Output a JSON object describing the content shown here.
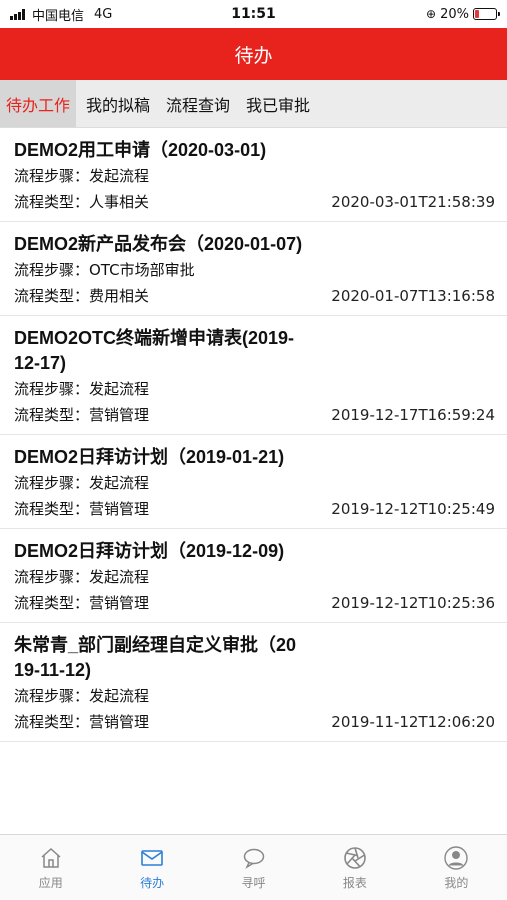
{
  "status_bar": {
    "carrier": "中国电信",
    "network": "4G",
    "time": "11:51",
    "battery_text": "20%",
    "battery_level": 0.2
  },
  "header": {
    "title": "待办"
  },
  "tabs": [
    {
      "label": "待办工作",
      "active": true
    },
    {
      "label": "我的拟稿",
      "active": false
    },
    {
      "label": "流程查询",
      "active": false
    },
    {
      "label": "我已审批",
      "active": false
    }
  ],
  "items": [
    {
      "title": "DEMO2用工申请（2020-03-01)",
      "step": "流程步骤：发起流程",
      "type": "流程类型：人事相关",
      "time": "2020-03-01T21:58:39"
    },
    {
      "title": "DEMO2新产品发布会（2020-01-07)",
      "step": "流程步骤：OTC市场部审批",
      "type": "流程类型：费用相关",
      "time": "2020-01-07T13:16:58"
    },
    {
      "title": "DEMO2OTC终端新增申请表(2019-12-17)",
      "step": "流程步骤：发起流程",
      "type": "流程类型：营销管理",
      "time": "2019-12-17T16:59:24"
    },
    {
      "title": "DEMO2日拜访计划（2019-01-21)",
      "step": "流程步骤：发起流程",
      "type": "流程类型：营销管理",
      "time": "2019-12-12T10:25:49"
    },
    {
      "title": "DEMO2日拜访计划（2019-12-09)",
      "step": "流程步骤：发起流程",
      "type": "流程类型：营销管理",
      "time": "2019-12-12T10:25:36"
    },
    {
      "title": "朱常青_部门副经理自定义审批（2019-11-12)",
      "step": "流程步骤：发起流程",
      "type": "流程类型：营销管理",
      "time": "2019-11-12T12:06:20"
    }
  ],
  "bottom_nav": [
    {
      "label": "应用",
      "icon": "home-icon",
      "active": false
    },
    {
      "label": "待办",
      "icon": "mail-icon",
      "active": true
    },
    {
      "label": "寻呼",
      "icon": "chat-icon",
      "active": false
    },
    {
      "label": "报表",
      "icon": "aperture-icon",
      "active": false
    },
    {
      "label": "我的",
      "icon": "user-icon",
      "active": false
    }
  ],
  "colors": {
    "brand": "#e8231d",
    "nav_active": "#2a7fd8",
    "tab_bg": "#ececec"
  }
}
